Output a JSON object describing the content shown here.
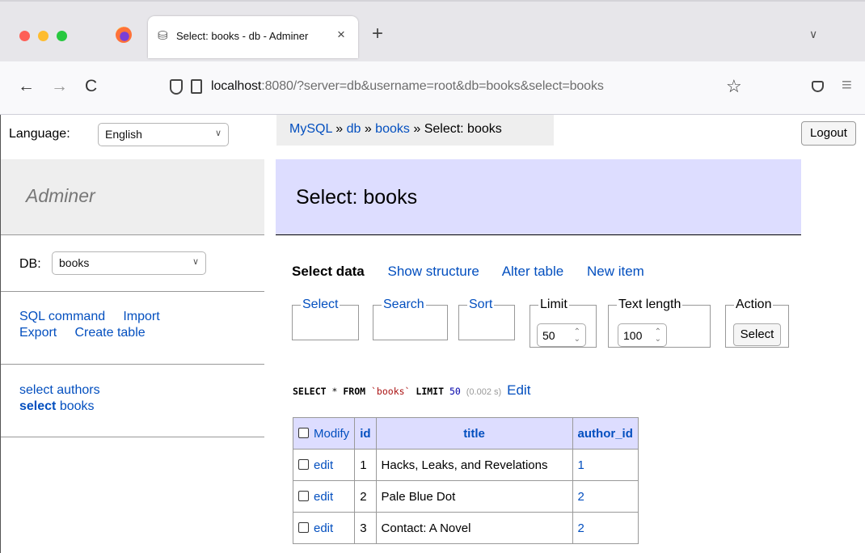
{
  "browser": {
    "tab_title": "Select: books - db - Adminer",
    "tab_close": "×",
    "new_tab": "+",
    "tab_list": "∨",
    "url_host": "localhost",
    "url_rest": ":8080/?server=db&username=root&db=books&select=books",
    "back": "←",
    "forward": "→",
    "reload": "C",
    "bookmark": "☆",
    "menu": "≡"
  },
  "sidebar": {
    "language_label": "Language:",
    "language_value": "English",
    "logo": "Adminer",
    "db_label": "DB:",
    "db_value": "books",
    "links": [
      "SQL command",
      "Import",
      "Export",
      "Create table"
    ],
    "tables": [
      {
        "prefix": "select",
        "name": "authors"
      },
      {
        "prefix": "select",
        "name": "books"
      }
    ]
  },
  "breadcrumb": {
    "mysql": "MySQL",
    "db": "db",
    "table": "books",
    "current": "Select: books",
    "sep": "»"
  },
  "logout": "Logout",
  "heading": "Select: books",
  "tabs": [
    "Select data",
    "Show structure",
    "Alter table",
    "New item"
  ],
  "fieldsets": {
    "select": "Select",
    "search": "Search",
    "sort": "Sort",
    "limit": "Limit",
    "limit_value": "50",
    "text_length": "Text length",
    "text_length_value": "100",
    "action": "Action",
    "action_button": "Select"
  },
  "query": {
    "select_kw": "SELECT",
    "star": "*",
    "from_kw": "FROM",
    "table": "`books`",
    "limit_kw": "LIMIT",
    "limit": "50",
    "time": "(0.002 s)",
    "edit": "Edit"
  },
  "table": {
    "headers": [
      "Modify",
      "id",
      "title",
      "author_id"
    ],
    "rows": [
      {
        "action": "edit",
        "id": "1",
        "title": "Hacks, Leaks, and Revelations",
        "author_id": "1"
      },
      {
        "action": "edit",
        "id": "2",
        "title": "Pale Blue Dot",
        "author_id": "2"
      },
      {
        "action": "edit",
        "id": "3",
        "title": "Contact: A Novel",
        "author_id": "2"
      }
    ]
  }
}
